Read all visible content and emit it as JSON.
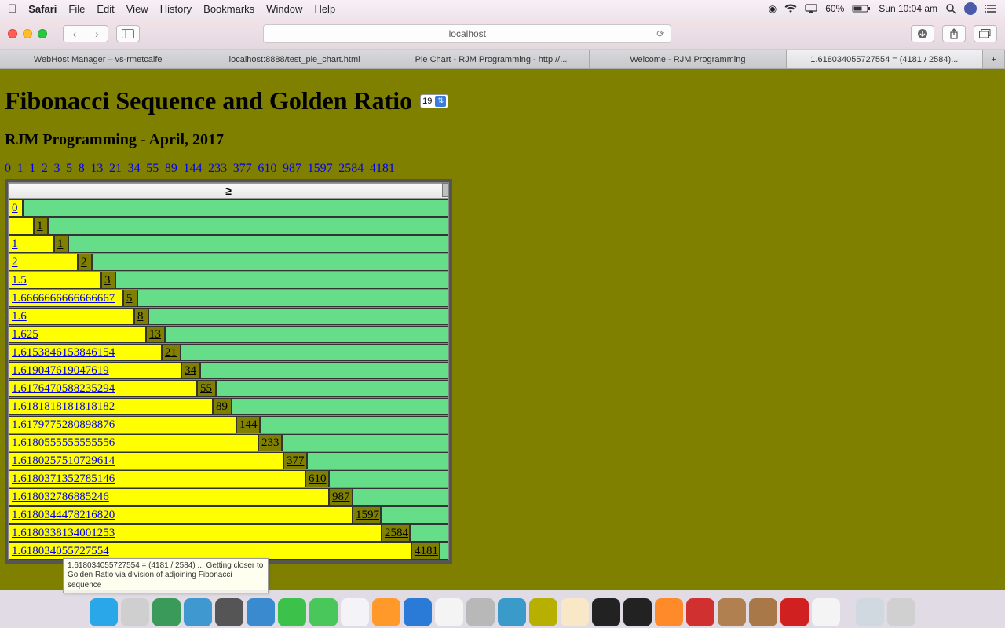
{
  "menubar": {
    "app": "Safari",
    "items": [
      "File",
      "Edit",
      "View",
      "History",
      "Bookmarks",
      "Window",
      "Help"
    ],
    "battery": "60%",
    "clock": "Sun 10:04 am"
  },
  "toolbar": {
    "url": "localhost"
  },
  "tabs": [
    "WebHost Manager – vs-rmetcalfe",
    "localhost:8888/test_pie_chart.html",
    "Pie Chart - RJM Programming - http://...",
    "Welcome - RJM Programming",
    "1.618034055727554 = (4181 / 2584)..."
  ],
  "active_tab_index": 4,
  "page": {
    "title": "Fibonacci Sequence and Golden Ratio",
    "select_value": "19",
    "subtitle": "RJM Programming - April, 2017",
    "sequence": [
      "0",
      "1",
      "1",
      "2",
      "3",
      "5",
      "8",
      "13",
      "21",
      "34",
      "55",
      "89",
      "144",
      "233",
      "377",
      "610",
      "987",
      "1597",
      "2584",
      "4181"
    ],
    "header_symbol": "≥",
    "rows": [
      {
        "ratio": "0",
        "ratio_w": 18,
        "fib": "",
        "fib_w": 0,
        "show_fib": false
      },
      {
        "ratio": "",
        "ratio_w": 32,
        "fib": "1",
        "fib_w": 18,
        "show_fib": true,
        "show_ratio": false
      },
      {
        "ratio": "1",
        "ratio_w": 58,
        "fib": "1",
        "fib_w": 18,
        "show_fib": true
      },
      {
        "ratio": "2",
        "ratio_w": 88,
        "fib": "2",
        "fib_w": 18,
        "show_fib": true
      },
      {
        "ratio": "1.5",
        "ratio_w": 118,
        "fib": "3",
        "fib_w": 18,
        "show_fib": true
      },
      {
        "ratio": "1.6666666666666667",
        "ratio_w": 146,
        "fib": "5",
        "fib_w": 18,
        "show_fib": true
      },
      {
        "ratio": "1.6",
        "ratio_w": 160,
        "fib": "8",
        "fib_w": 18,
        "show_fib": true
      },
      {
        "ratio": "1.625",
        "ratio_w": 175,
        "fib": "13",
        "fib_w": 24,
        "show_fib": true
      },
      {
        "ratio": "1.6153846153846154",
        "ratio_w": 195,
        "fib": "21",
        "fib_w": 24,
        "show_fib": true
      },
      {
        "ratio": "1.619047619047619",
        "ratio_w": 220,
        "fib": "34",
        "fib_w": 24,
        "show_fib": true
      },
      {
        "ratio": "1.6176470588235294",
        "ratio_w": 240,
        "fib": "55",
        "fib_w": 24,
        "show_fib": true
      },
      {
        "ratio": "1.6181818181818182",
        "ratio_w": 260,
        "fib": "89",
        "fib_w": 24,
        "show_fib": true
      },
      {
        "ratio": "1.6179775280898876",
        "ratio_w": 290,
        "fib": "144",
        "fib_w": 30,
        "show_fib": true
      },
      {
        "ratio": "1.6180555555555556",
        "ratio_w": 318,
        "fib": "233",
        "fib_w": 30,
        "show_fib": true
      },
      {
        "ratio": "1.6180257510729614",
        "ratio_w": 350,
        "fib": "377",
        "fib_w": 30,
        "show_fib": true
      },
      {
        "ratio": "1.6180371352785146",
        "ratio_w": 378,
        "fib": "610",
        "fib_w": 30,
        "show_fib": true
      },
      {
        "ratio": "1.618032786885246",
        "ratio_w": 408,
        "fib": "987",
        "fib_w": 30,
        "show_fib": true
      },
      {
        "ratio": "1.6180344478216820",
        "ratio_w": 438,
        "fib": "1597",
        "fib_w": 36,
        "show_fib": true
      },
      {
        "ratio": "1.6180338134001253",
        "ratio_w": 475,
        "fib": "2584",
        "fib_w": 36,
        "show_fib": true
      },
      {
        "ratio": "1.618034055727554",
        "ratio_w": 513,
        "fib": "4181",
        "fib_w": 36,
        "show_fib": true
      }
    ]
  },
  "tooltip": "1.618034055727554 = (4181 / 2584) ... Getting closer to Golden Ratio via division of adjoining Fibonacci sequence",
  "dock": [
    {
      "name": "finder",
      "bg": "#2aa7e8"
    },
    {
      "name": "launchpad",
      "bg": "#cfcfcf"
    },
    {
      "name": "activity",
      "bg": "#3a9a5a"
    },
    {
      "name": "preview",
      "bg": "#4098d0"
    },
    {
      "name": "photos",
      "bg": "#555"
    },
    {
      "name": "safari",
      "bg": "#3a8ad0"
    },
    {
      "name": "messages",
      "bg": "#3cc24a"
    },
    {
      "name": "messages2",
      "bg": "#4ac75a"
    },
    {
      "name": "itunes",
      "bg": "#f4f4f8"
    },
    {
      "name": "ibooks",
      "bg": "#ff9a2a"
    },
    {
      "name": "appstore",
      "bg": "#2a7ad8"
    },
    {
      "name": "calendar",
      "bg": "#f4f4f4"
    },
    {
      "name": "settings",
      "bg": "#b8b8b8"
    },
    {
      "name": "mamp",
      "bg": "#3a9aca"
    },
    {
      "name": "app1",
      "bg": "#b8b000"
    },
    {
      "name": "app2",
      "bg": "#f8e8c8"
    },
    {
      "name": "terminal",
      "bg": "#222"
    },
    {
      "name": "mamp2",
      "bg": "#222"
    },
    {
      "name": "firefox",
      "bg": "#ff8a2a"
    },
    {
      "name": "opera",
      "bg": "#d03030"
    },
    {
      "name": "app3",
      "bg": "#b08050"
    },
    {
      "name": "gimp",
      "bg": "#a87848"
    },
    {
      "name": "filezilla",
      "bg": "#d02020"
    },
    {
      "name": "chrome",
      "bg": "#f4f4f4"
    },
    {
      "name": "spacer",
      "bg": "transparent"
    },
    {
      "name": "folder",
      "bg": "#d0d8e0"
    },
    {
      "name": "trash",
      "bg": "#d0d0d0"
    }
  ]
}
